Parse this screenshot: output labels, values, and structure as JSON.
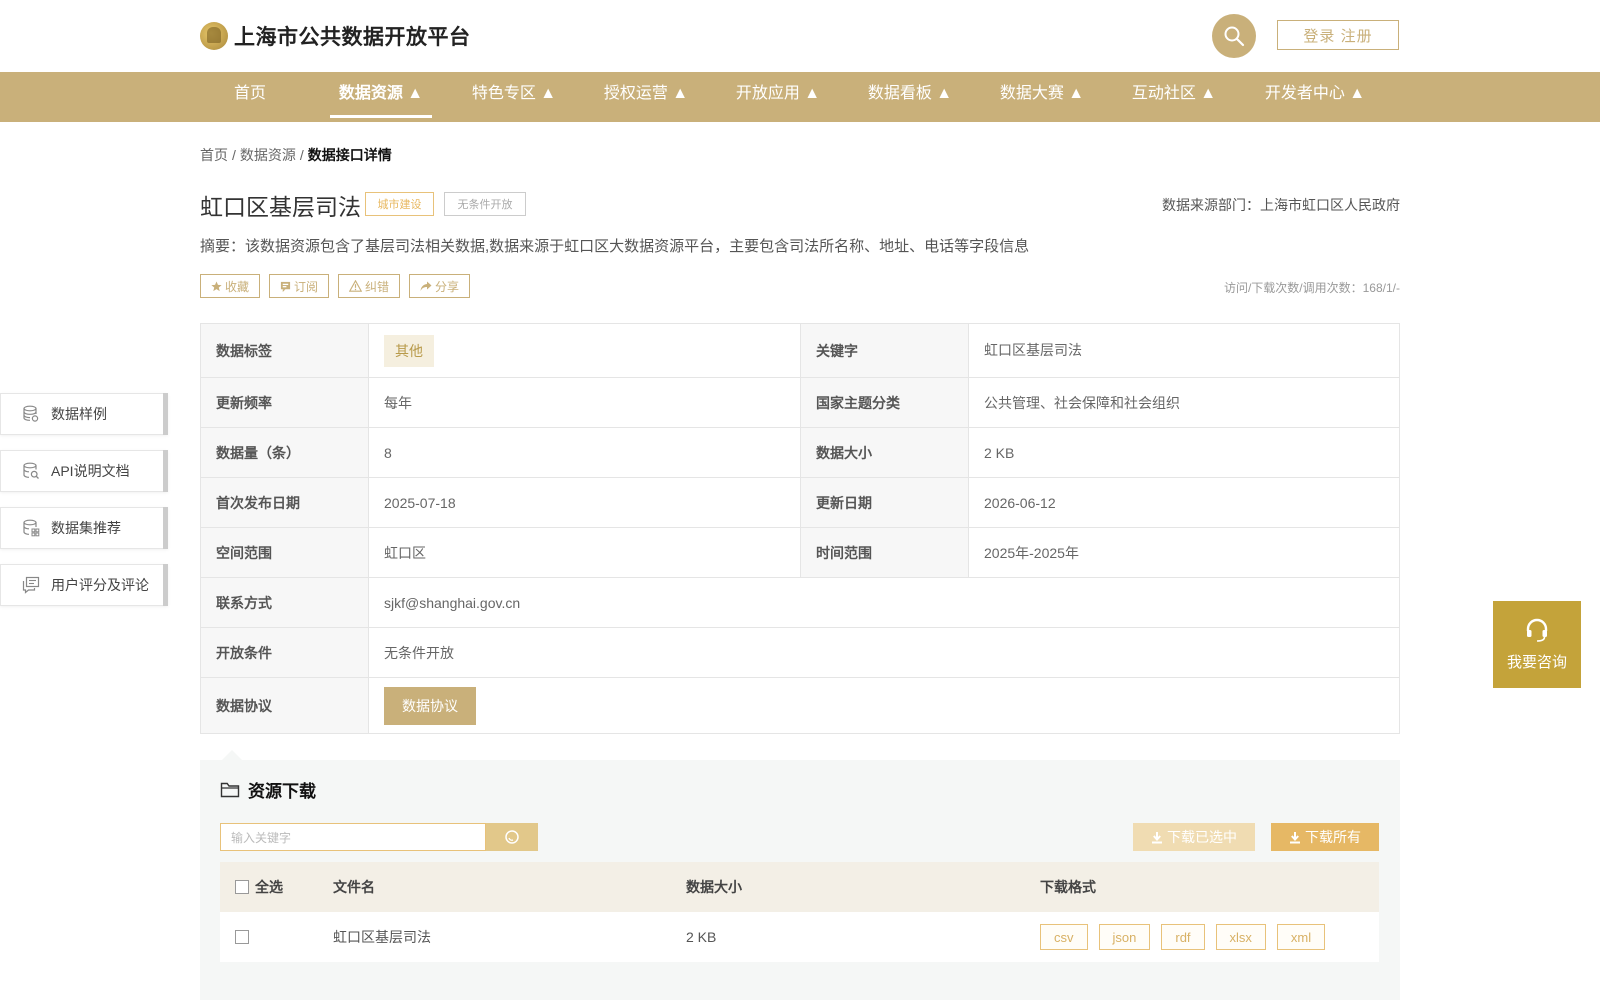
{
  "header": {
    "site_title": "上海市公共数据开放平台",
    "login_label": "登录 注册"
  },
  "nav": [
    {
      "label": "首页"
    },
    {
      "label": "数据资源 ▲"
    },
    {
      "label": "特色专区 ▲"
    },
    {
      "label": "授权运营 ▲"
    },
    {
      "label": "开放应用 ▲"
    },
    {
      "label": "数据看板 ▲"
    },
    {
      "label": "数据大赛 ▲"
    },
    {
      "label": "互动社区 ▲"
    },
    {
      "label": "开发者中心 ▲"
    }
  ],
  "breadcrumb": {
    "home": "首页",
    "level2": "数据资源",
    "current": "数据接口详情",
    "separator": "/"
  },
  "detail": {
    "title": "虹口区基层司法",
    "tag_category": "城市建设",
    "tag_open": "无条件开放",
    "source_dept": "数据来源部门：上海市虹口区人民政府",
    "abstract": "摘要：该数据资源包含了基层司法相关数据,数据来源于虹口区大数据资源平台，主要包含司法所名称、地址、电话等字段信息",
    "stats": "访问/下载次数/调用次数：168/1/-"
  },
  "actions": [
    {
      "label": "收藏",
      "icon": "star-icon"
    },
    {
      "label": "订阅",
      "icon": "subscribe-icon"
    },
    {
      "label": "纠错",
      "icon": "warning-icon"
    },
    {
      "label": "分享",
      "icon": "share-icon"
    }
  ],
  "info": {
    "tag_label": "数据标签",
    "tag_value": "其他",
    "keyword_label": "关键字",
    "keyword_value": "虹口区基层司法",
    "freq_label": "更新频率",
    "freq_value": "每年",
    "theme_label": "国家主题分类",
    "theme_value": "公共管理、社会保障和社会组织",
    "count_label": "数据量（条）",
    "count_value": "8",
    "size_label": "数据大小",
    "size_value": "2 KB",
    "first_label": "首次发布日期",
    "first_value": "2025-07-18",
    "update_label": "更新日期",
    "update_value": "2026-06-12",
    "space_label": "空间范围",
    "space_value": "虹口区",
    "time_label": "时间范围",
    "time_value": "2025年-2025年",
    "contact_label": "联系方式",
    "contact_value": "sjkf@shanghai.gov.cn",
    "cond_label": "开放条件",
    "cond_value": "无条件开放",
    "protocol_label": "数据协议",
    "protocol_button": "数据协议"
  },
  "side_menu": [
    {
      "label": "数据样例",
      "icon": "database-icon"
    },
    {
      "label": "API说明文档",
      "icon": "doc-search-icon"
    },
    {
      "label": "数据集推荐",
      "icon": "dataset-icon"
    },
    {
      "label": "用户评分及评论",
      "icon": "comment-icon"
    }
  ],
  "consult": {
    "label": "我要咨询"
  },
  "download": {
    "title": "资源下载",
    "search_placeholder": "输入关键字",
    "download_selected": "下载已选中",
    "download_all": "下载所有",
    "columns": [
      "全选",
      "文件名",
      "数据大小",
      "下载格式"
    ],
    "rows": [
      {
        "name": "虹口区基层司法",
        "size": "2 KB",
        "formats": [
          "csv",
          "json",
          "rdf",
          "xlsx",
          "xml"
        ]
      }
    ]
  },
  "colors": {
    "accent": "#c9b07a",
    "accent_dark": "#c4a33a",
    "orange": "#e6b865"
  }
}
